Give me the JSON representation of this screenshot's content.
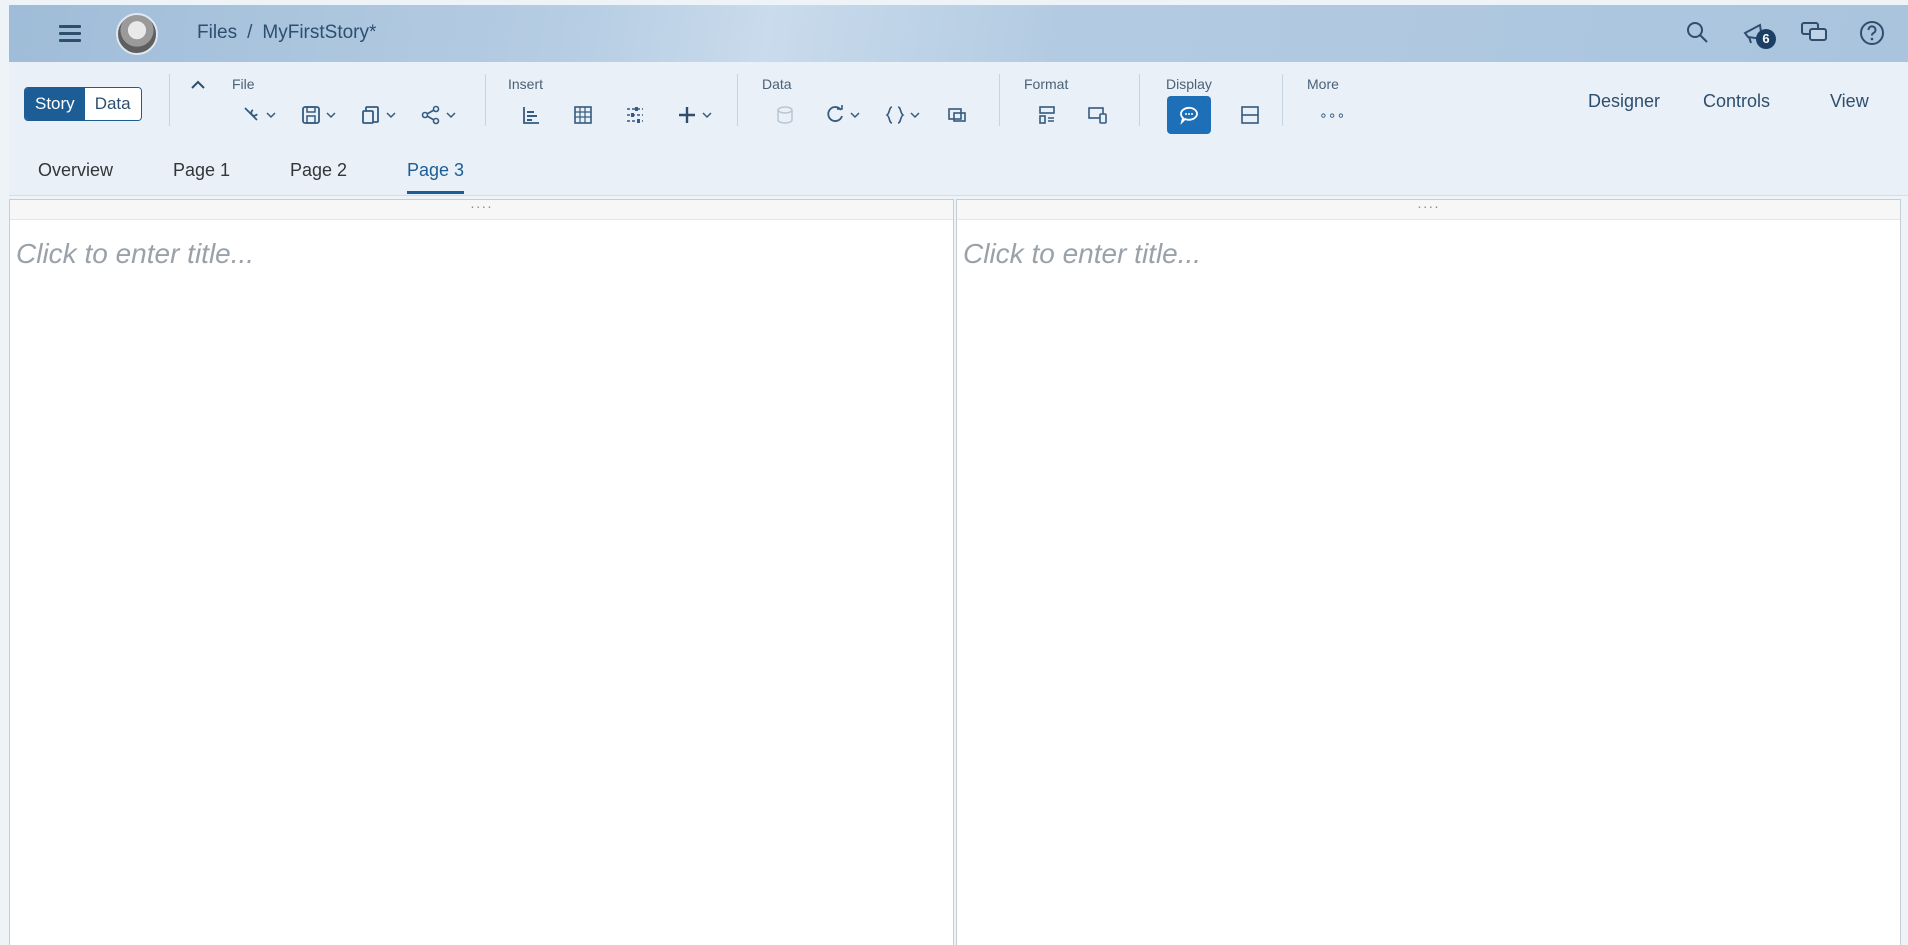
{
  "shell": {
    "breadcrumb_root": "Files",
    "breadcrumb_sep": "/",
    "story_name": "MyFirstStory*",
    "notification_count": "6"
  },
  "toolbar": {
    "mode_story": "Story",
    "mode_data": "Data",
    "groups": {
      "file": "File",
      "insert": "Insert",
      "data": "Data",
      "format": "Format",
      "display": "Display",
      "more": "More"
    },
    "more_dots": "∘∘∘",
    "right_links": [
      "Designer",
      "Controls",
      "View"
    ]
  },
  "tabs": [
    "Overview",
    "Page 1",
    "Page 2",
    "Page 3"
  ],
  "active_tab": "Page 3",
  "panels": [
    {
      "handle": "····",
      "title_placeholder": "Click to enter title..."
    },
    {
      "handle": "····",
      "title_placeholder": "Click to enter title..."
    }
  ],
  "colors": {
    "accent": "#1d5d96",
    "shell_bg": "#b6cde3",
    "toolbar_bg": "#e9f0f7"
  }
}
